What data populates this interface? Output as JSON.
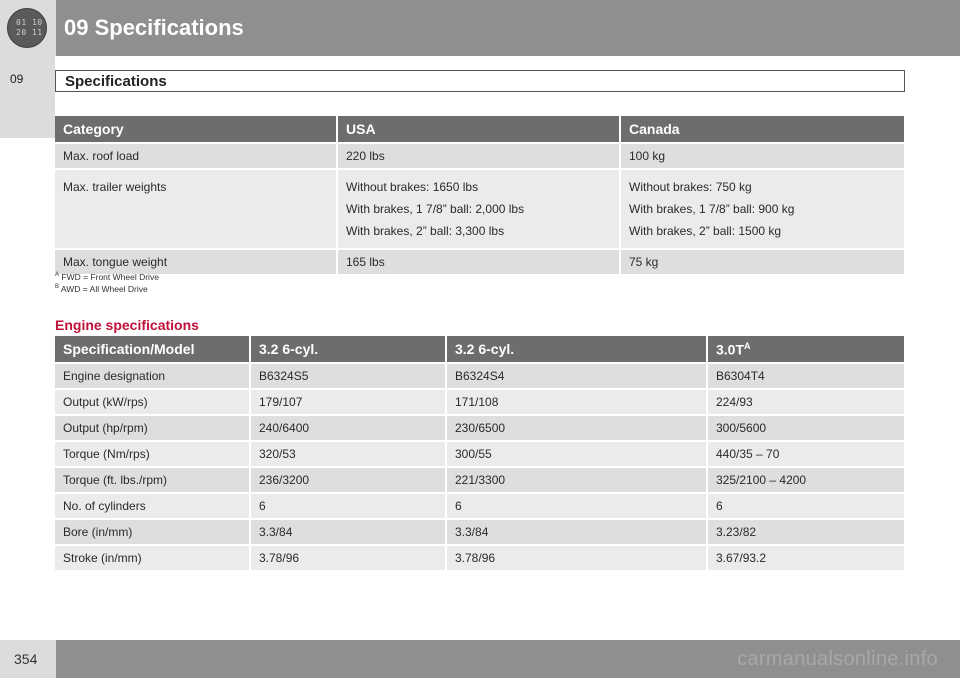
{
  "header": {
    "badge_line1": "01 10",
    "badge_line2": "20 11",
    "title": "09  Specifications"
  },
  "side_tab": "09",
  "section_title": "Specifications",
  "load_table": {
    "headers": [
      "Category",
      "USA",
      "Canada"
    ],
    "rows": [
      {
        "category": "Max. roof load",
        "usa": [
          "220 lbs"
        ],
        "canada": [
          "100 kg"
        ]
      },
      {
        "category": "Max. trailer weights",
        "usa": [
          "Without brakes: 1650 lbs",
          "With brakes, 1 7/8” ball: 2,000 lbs",
          "With brakes, 2” ball: 3,300 lbs"
        ],
        "canada": [
          "Without brakes: 750 kg",
          "With brakes, 1 7/8” ball: 900 kg",
          "With brakes, 2” ball: 1500 kg"
        ]
      },
      {
        "category": "Max. tongue weight",
        "usa": [
          "165 lbs"
        ],
        "canada": [
          "75 kg"
        ]
      }
    ]
  },
  "footnotes": [
    {
      "mark": "A",
      "text": "FWD = Front Wheel Drive"
    },
    {
      "mark": "B",
      "text": "AWD = All Wheel Drive"
    }
  ],
  "engine_heading": "Engine specifications",
  "engine_table": {
    "headers": [
      "Specification/Model",
      "3.2 6-cyl.",
      "3.2 6-cyl.",
      "3.0T"
    ],
    "header_sup": "A",
    "rows": [
      [
        "Engine designation",
        "B6324S5",
        "B6324S4",
        "B6304T4"
      ],
      [
        "Output (kW/rps)",
        "179/107",
        "171/108",
        "224/93"
      ],
      [
        "Output (hp/rpm)",
        "240/6400",
        "230/6500",
        "300/5600"
      ],
      [
        "Torque (Nm/rps)",
        "320/53",
        "300/55",
        "440/35 – 70"
      ],
      [
        "Torque (ft. lbs./rpm)",
        "236/3200",
        "221/3300",
        "325/2100 – 4200"
      ],
      [
        "No. of cylinders",
        "6",
        "6",
        "6"
      ],
      [
        "Bore (in/mm)",
        "3.3/84",
        "3.3/84",
        "3.23/82"
      ],
      [
        "Stroke (in/mm)",
        "3.78/96",
        "3.78/96",
        "3.67/93.2"
      ]
    ]
  },
  "footer": {
    "page_number": "354",
    "watermark": "carmanualsonline.info"
  }
}
